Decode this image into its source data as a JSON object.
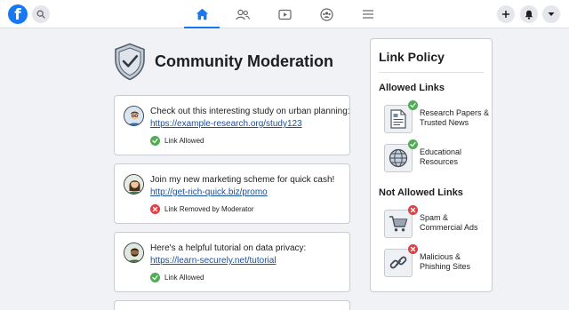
{
  "topbar": {
    "logo_letter": "f",
    "search_icon": "search-icon",
    "nav": [
      {
        "icon": "home-icon",
        "active": true
      },
      {
        "icon": "friends-icon",
        "active": false
      },
      {
        "icon": "watch-video-icon",
        "active": false
      },
      {
        "icon": "groups-icon",
        "active": false
      },
      {
        "icon": "menu-icon",
        "active": false
      }
    ],
    "actions": [
      "plus-icon",
      "bell-icon",
      "caret-down-icon"
    ],
    "accent_color": "#1877f2"
  },
  "page": {
    "title": "Community Moderation",
    "icon": "shield-check-icon"
  },
  "posts": [
    {
      "avatar": "avatar-man-glasses",
      "text": "Check out this interesting study on urban planning:",
      "link": "https://example-research.org/study123",
      "status": "Link Allowed",
      "status_type": "allowed"
    },
    {
      "avatar": "avatar-woman",
      "text": "Join my new marketing scheme for quick cash!",
      "link": "http://get-rich-quick.biz/promo",
      "status": "Link Removed by Moderator",
      "status_type": "removed"
    },
    {
      "avatar": "avatar-man-beard",
      "text": "Here's a helpful tutorial on data privacy:",
      "link": "https://learn-securely.net/tutorial",
      "status": "Link Allowed",
      "status_type": "allowed"
    }
  ],
  "policy": {
    "title": "Link Policy",
    "allowed_heading": "Allowed Links",
    "allowed": [
      {
        "label": "Research Papers & Trusted News",
        "icon": "document-icon"
      },
      {
        "label": "Educational Resources",
        "icon": "globe-icon"
      }
    ],
    "not_allowed_heading": "Not Allowed Links",
    "not_allowed": [
      {
        "label": "Spam & Commercial Ads",
        "icon": "shopping-cart-icon"
      },
      {
        "label": "Malicious & Phishing Sites",
        "icon": "broken-link-icon"
      }
    ]
  },
  "colors": {
    "allowed": "#4caf50",
    "removed": "#e53e3e",
    "link": "#1a4f9c"
  }
}
